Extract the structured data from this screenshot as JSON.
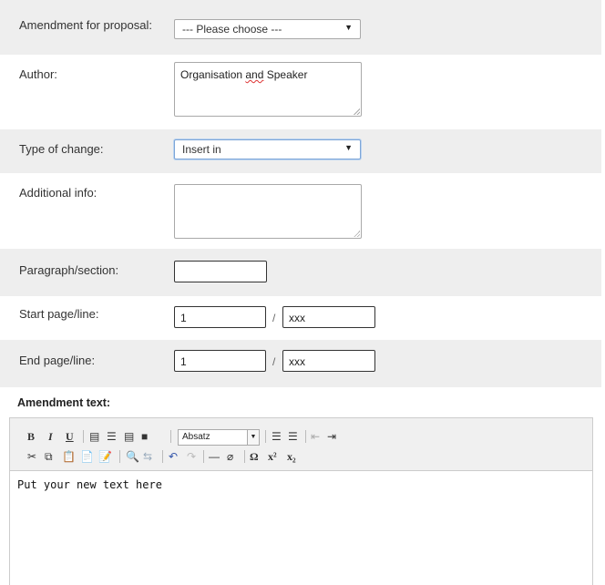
{
  "form": {
    "proposal": {
      "label": "Amendment for proposal:",
      "value": "--- Please choose ---"
    },
    "author": {
      "label": "Author:",
      "value_pre": "Organisation ",
      "value_spell": "and",
      "value_post": " Speaker"
    },
    "type_of_change": {
      "label": "Type of change:",
      "value": "Insert in"
    },
    "additional_info": {
      "label": "Additional info:",
      "value": ""
    },
    "paragraph": {
      "label": "Paragraph/section:",
      "value": ""
    },
    "start": {
      "label": "Start page/line:",
      "page": "1",
      "separator": "/",
      "line": "xxx"
    },
    "end": {
      "label": "End page/line:",
      "page": "1",
      "separator": "/",
      "line": "xxx"
    }
  },
  "editor": {
    "label": "Amendment text:",
    "block_format": "Absatz",
    "content": "Put your new text here",
    "toolbar": {
      "bold": "B",
      "italic": "I",
      "underline": "U",
      "special_char": "Ω",
      "superscript": "x²",
      "subscript": "x₂"
    }
  },
  "colors": {
    "row_alt": "#eeeeee",
    "focus": "#7da6d8"
  }
}
